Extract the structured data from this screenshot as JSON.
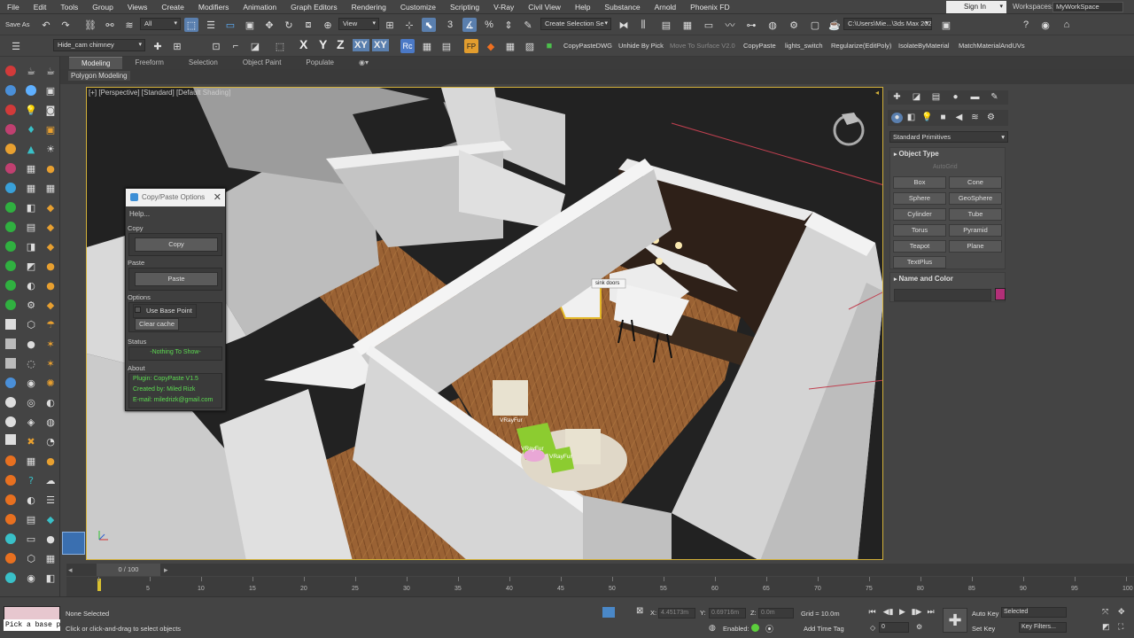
{
  "menu": [
    "File",
    "Edit",
    "Tools",
    "Group",
    "Views",
    "Create",
    "Modifiers",
    "Animation",
    "Graph Editors",
    "Rendering",
    "Customize",
    "Scripting",
    "V-Ray",
    "Civil View",
    "Help",
    "Substance",
    "Arnold",
    "Phoenix FD"
  ],
  "signin": "Sign In",
  "workspaces": {
    "label": "Workspaces:",
    "value": "MyWorkSpace"
  },
  "toolbar1": {
    "save_as": "Save As",
    "filter": "All",
    "view_combo": "View",
    "selection_set": "Create Selection Se",
    "path": "C:\\Users\\Mie...\\3ds Max 2023"
  },
  "toolbar2": {
    "layer": "Hide_cam chimney",
    "xyz": [
      "X",
      "Y",
      "Z",
      "XY",
      "XY"
    ],
    "scripts": [
      "CopyPasteDWG",
      "Unhide By Pick",
      "Move To Surface V2.0",
      "CopyPaste",
      "lights_switch",
      "Regularize(EditPoly)",
      "IsolateByMaterial",
      "MatchMaterialAndUVs"
    ]
  },
  "ribbon": {
    "tabs": [
      "Modeling",
      "Freeform",
      "Selection",
      "Object Paint",
      "Populate"
    ],
    "panel": "Polygon Modeling"
  },
  "viewport": {
    "label": "[+] [Perspective] [Standard] [Default Shading]",
    "tooltip": "sink doors",
    "fur_labels": [
      "VRayFur",
      "VRayFur",
      "VRayFur"
    ]
  },
  "dialog": {
    "title": "Copy/Paste Options",
    "help": "Help...",
    "copy_group": "Copy",
    "copy_btn": "Copy",
    "paste_group": "Paste",
    "paste_btn": "Paste",
    "options_group": "Options",
    "use_base_point": "Use Base Point",
    "clear_cache": "Clear cache",
    "status_group": "Status",
    "status_text": "-Nothing To Show-",
    "about_group": "About",
    "about_lines": [
      "Plugin: CopyPaste V1.5",
      "Created by: Miled Rizk",
      "E-mail: miledrizk@gmail.com"
    ]
  },
  "command_panel": {
    "dropdown": "Standard Primitives",
    "object_type": "Object Type",
    "autogrid": "AutoGrid",
    "primitives": [
      "Box",
      "Cone",
      "Sphere",
      "GeoSphere",
      "Cylinder",
      "Tube",
      "Torus",
      "Pyramid",
      "Teapot",
      "Plane",
      "TextPlus"
    ],
    "name_and_color": "Name and Color",
    "color": "#b22f78"
  },
  "timeline": {
    "slider": "0 / 100",
    "ticks": [
      "0",
      "5",
      "10",
      "15",
      "20",
      "25",
      "30",
      "35",
      "40",
      "45",
      "50",
      "55",
      "60",
      "65",
      "70",
      "75",
      "80",
      "85",
      "90",
      "95",
      "100"
    ]
  },
  "status": {
    "pick": "Pick a base p",
    "selected": "None Selected",
    "prompt": "Click or click-and-drag to select objects",
    "x_label": "X:",
    "x_val": "4.45173m",
    "y_label": "Y:",
    "y_val": "0.69716m",
    "z_label": "Z:",
    "z_val": "0.0m",
    "grid": "Grid = 10.0m",
    "enabled": "Enabled:",
    "add_time_tag": "Add Time Tag",
    "frame": "0",
    "auto_key": "Auto Key",
    "selected_combo": "Selected",
    "set_key": "Set Key",
    "key_filters": "Key Filters..."
  }
}
